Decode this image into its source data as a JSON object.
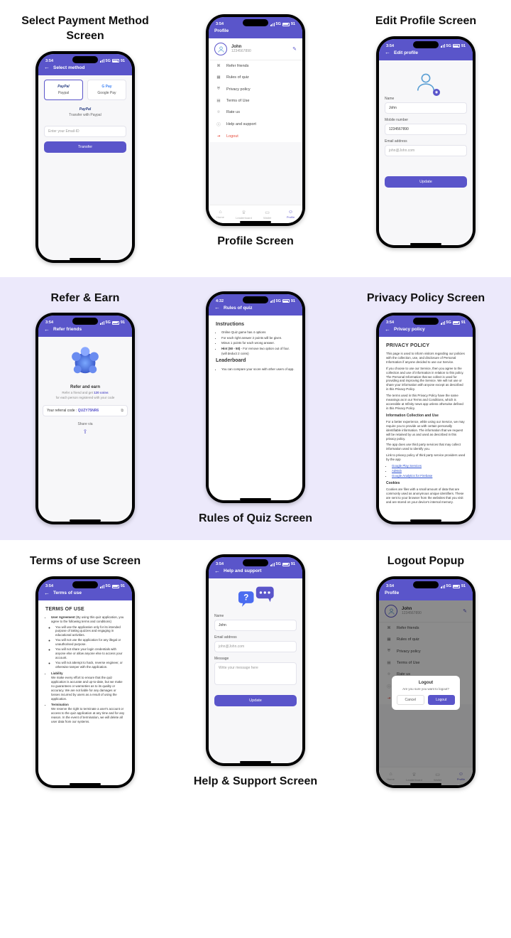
{
  "status": {
    "time": "3:54",
    "time2": "4:32",
    "net": "5G",
    "batt": "91"
  },
  "captions": {
    "payment": "Select Payment Method Screen",
    "profile": "Profile Screen",
    "edit": "Edit Profile Screen",
    "refer": "Refer & Earn",
    "rules": "Rules of Quiz Screen",
    "privacy": "Privacy Policy Screen",
    "terms": "Terms of use Screen",
    "help": "Help & Support Screen",
    "logout": "Logout Popup"
  },
  "payment": {
    "header": "Select method",
    "paypal_logo": "PayPal",
    "paypal_name": "Paypal",
    "gpay_logo": "G Pay",
    "gpay_name": "Google Pay",
    "center_logo": "PayPal",
    "sub": "Transfer with Paypal",
    "email_ph": "Enter your Email-ID",
    "btn": "Transfer"
  },
  "profile": {
    "header": "Profile",
    "name": "John",
    "phone": "1234567890",
    "items": {
      "refer": "Refer friends",
      "rules": "Rules of quiz",
      "privacy": "Privacy policy",
      "terms": "Terms of Use",
      "rate": "Rate us",
      "help": "Help and support",
      "logout": "Logout"
    },
    "tabs": {
      "home": "Home",
      "leader": "Leaderboard",
      "wallet": "Wallet",
      "profile": "Profile"
    }
  },
  "edit": {
    "header": "Edit profile",
    "labels": {
      "name": "Name",
      "mobile": "Mobile number",
      "email": "Email address"
    },
    "values": {
      "name": "John",
      "mobile": "1234567890",
      "email": "john@John.com"
    },
    "btn": "Update"
  },
  "refer": {
    "header": "Refer friends",
    "title": "Refer and earn",
    "sub_a": "Refer a friend and get ",
    "sub_b": "120 coins",
    "sub_c": "for each person registered with your code",
    "code_label": "Your referral code : ",
    "code": "QUZY75NR6",
    "share": "Share via"
  },
  "rules": {
    "header": "Rules of quiz",
    "h1": "Instructions",
    "b1": "Online Quiz game has 4 options",
    "b2": "For each right answer 2 points will be given.",
    "b3": "Minus 1 points for each wrong answer.",
    "b4_a": "Hint (50 - 50)",
    "b4_b": " - For remove two option out of four. (will deduct 2 coins)",
    "h2": "Leaderboard",
    "b5": "You can compare your score with other users of app."
  },
  "privacy": {
    "header": "Privacy policy",
    "title": "PRIVACY POLICY",
    "p1": "This page is used to inform visitors regarding our policies with the collection, use, and disclosure of Personal Information if anyone decided to use our Service.",
    "p2": "If you choose to use our Service, then you agree to the collection and use of information in relation to this policy. The Personal Information that we collect is used for providing and improving the Service. We will not use or share your information with anyone except as described in this Privacy Policy.",
    "p3": "The terms used in this Privacy Policy have the same meanings as in our Terms and Conditions, which is accessible at Infinity news app unless otherwise defined in this Privacy Policy.",
    "h1": "Information Collection and Use",
    "p4": "For a better experience, while using our Service, we may require you to provide us with certain personally identifiable information. The information that we request will be retained by us and used as described in this privacy policy.",
    "p5": "The app does use third party services that may collect information used to identify you.",
    "p6": "Link to privacy policy of third party service providers used by the app",
    "l1": "Google Play Services",
    "l2": "AdMob",
    "l3": "Google Analytics for Firebase",
    "h2": "Cookies",
    "p7": "Cookies are files with a small amount of data that are commonly used as anonymous unique identifiers. These are sent to your browser from the websites that you visit and are stored on your device's internal memory."
  },
  "terms": {
    "header": "Terms of use",
    "title": "TERMS OF USE",
    "ua_a": "User Agreement",
    "ua_b": " (By using this quiz application, you agree to the following terms and conditions)",
    "b1": "You will use the application only for its intended purpose of taking quizzes and engaging in educational activities.",
    "b2": "You will not use the application for any illegal or unauthorised purpose.",
    "b3": "You will not share your login credentials with anyone else or allow anyone else to access your account.",
    "b4": "You will not attempt to hack, reverse engineer, or otherwise tamper with the application.",
    "li_a": "Liability",
    "li_b": "We make every effort to ensure that the quiz application is accurate and up-to-date, but we make no guarantees or warranties as to its quality or accuracy. We are not liable for any damages or losses incurred by users as a result of using the application.",
    "te_a": "Termination",
    "te_b": "We reserve the right to terminate a user's account or access to the quiz application at any time and for any reason. In the event of termination, we will delete all user data from our systems."
  },
  "help": {
    "header": "Help and support",
    "labels": {
      "name": "Name",
      "email": "Email address",
      "msg": "Message"
    },
    "ph": {
      "name": "John",
      "email": "john@John.com",
      "msg": "Write your message here"
    },
    "btn": "Update"
  },
  "logout": {
    "title": "Logout",
    "msg": "Are you sure you want to logout?",
    "cancel": "Cancel",
    "ok": "Logout"
  }
}
